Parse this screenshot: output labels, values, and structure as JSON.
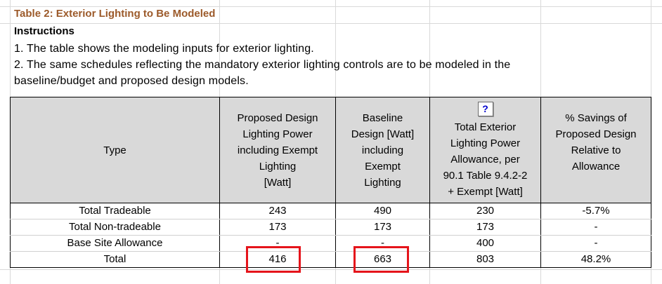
{
  "sheet": {
    "title": "Table 2: Exterior Lighting to Be Modeled",
    "instructions_heading": "Instructions",
    "instructions": [
      "1. The table shows the modeling inputs for exterior lighting.",
      "2. The same schedules reflecting the mandatory exterior lighting controls are to be modeled in the",
      "baseline/budget and proposed design models."
    ]
  },
  "table": {
    "headers": {
      "type": "Type",
      "proposed": [
        "Proposed Design",
        "Lighting Power",
        "including Exempt",
        "Lighting",
        "[Watt]"
      ],
      "baseline": [
        "Baseline",
        "Design [Watt]",
        "including",
        "Exempt",
        "Lighting"
      ],
      "allowance_button": "?",
      "allowance": [
        "Total Exterior",
        "Lighting Power",
        "Allowance, per",
        "90.1 Table 9.4.2-2",
        "+ Exempt [Watt]"
      ],
      "savings": [
        "% Savings of",
        "Proposed Design",
        "Relative to",
        "Allowance"
      ]
    },
    "rows": [
      {
        "type": "Total Tradeable",
        "proposed": "243",
        "baseline": "490",
        "allowance": "230",
        "savings": "-5.7%"
      },
      {
        "type": "Total Non-tradeable",
        "proposed": "173",
        "baseline": "173",
        "allowance": "173",
        "savings": "-"
      },
      {
        "type": "Base Site Allowance",
        "proposed": "-",
        "baseline": "-",
        "allowance": "400",
        "savings": "-"
      },
      {
        "type": "Total",
        "proposed": "416",
        "baseline": "663",
        "allowance": "803",
        "savings": "48.2%"
      }
    ]
  },
  "colors": {
    "title": "#9c5a2a",
    "header_fill": "#d9d9d9",
    "highlight": "#e5141b",
    "help_button_text": "#0000cc"
  }
}
